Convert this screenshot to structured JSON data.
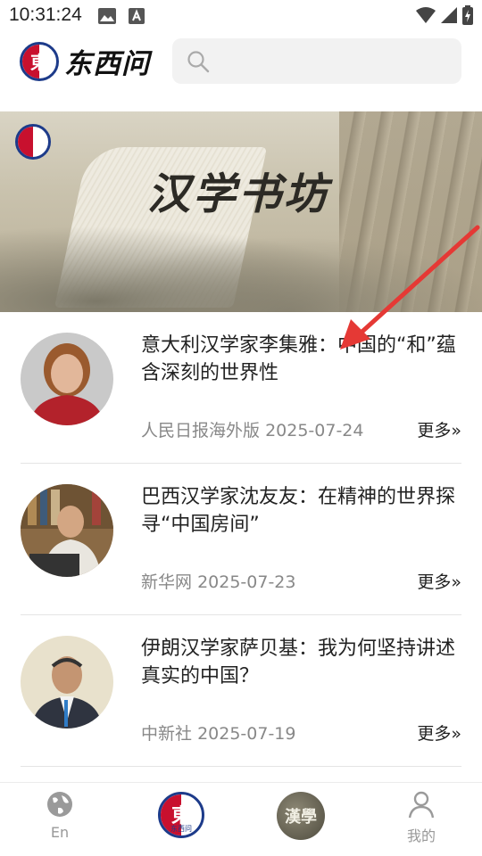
{
  "status_bar": {
    "time": "10:31:24"
  },
  "header": {
    "logo_text": "东西问",
    "search": {
      "placeholder": ""
    }
  },
  "banner": {
    "title": "汉学书坊"
  },
  "articles": [
    {
      "title": "意大利汉学家李集雅：中国的“和”蕴含深刻的世界性",
      "source": "人民日报海外版",
      "date": "2025-07-24",
      "more_label": "更多"
    },
    {
      "title": "巴西汉学家沈友友：在精神的世界探寻“中国房间”",
      "source": "新华网",
      "date": "2025-07-23",
      "more_label": "更多"
    },
    {
      "title": "伊朗汉学家萨贝基：我为何坚持讲述真实的中国？",
      "source": "中新社",
      "date": "2025-07-19",
      "more_label": "更多"
    }
  ],
  "bottom_nav": {
    "items": [
      {
        "label": "En",
        "icon": "globe-icon"
      },
      {
        "label": "东西问",
        "icon": "brand-logo-icon"
      },
      {
        "label": "漢學",
        "icon": "hanxue-seal-icon"
      },
      {
        "label": "我的",
        "icon": "person-icon"
      }
    ]
  },
  "colors": {
    "brand_red": "#c8102e",
    "brand_blue": "#1d3b8a",
    "annotation_arrow": "#e53935"
  }
}
